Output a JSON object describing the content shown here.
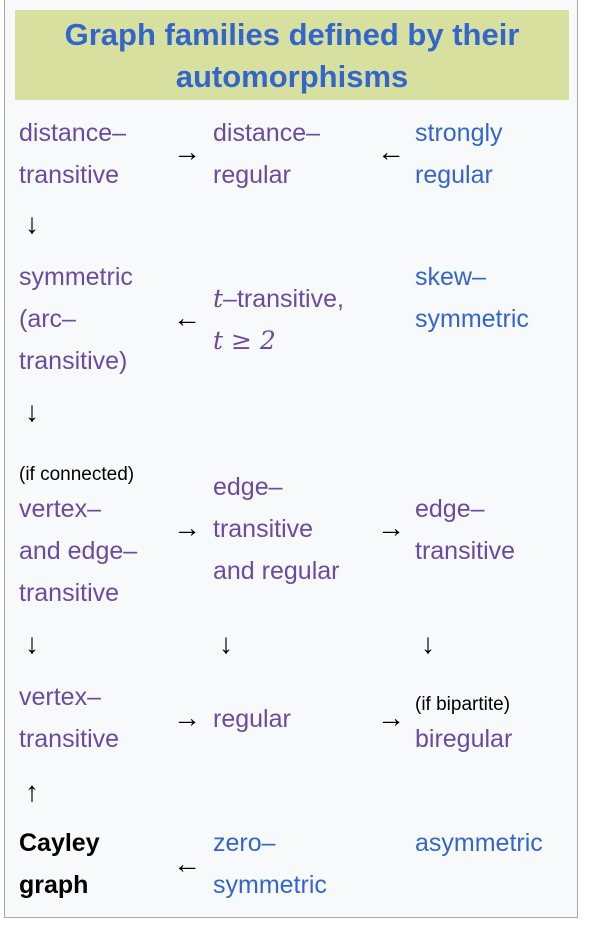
{
  "title": "Graph families defined by their automorphisms",
  "title_color": "#3366cc",
  "title_bg": "#d8e0a0",
  "link_color": "#3366cc",
  "visited_color": "#6b4ba1",
  "nodes": {
    "distance_transitive": [
      "distance–",
      "transitive"
    ],
    "distance_regular": [
      "distance–",
      "regular"
    ],
    "strongly_regular": [
      "strongly",
      "regular"
    ],
    "symmetric": [
      "symmetric",
      "(arc–",
      "transitive)"
    ],
    "t_transitive": {
      "t": "t",
      "rest": "–transitive,",
      "condition": "t ≥ 2"
    },
    "skew_symmetric": [
      "skew–",
      "symmetric"
    ],
    "vertex_and_edge": {
      "note": "(if connected)",
      "lines": [
        "vertex–",
        "and edge–",
        "transitive"
      ]
    },
    "edge_transitive_regular": [
      "edge–",
      "transitive",
      "and regular"
    ],
    "edge_transitive": [
      "edge–",
      "transitive"
    ],
    "vertex_transitive": [
      "vertex–",
      "transitive"
    ],
    "regular": "regular",
    "biregular": {
      "note": "(if bipartite)",
      "label": "biregular"
    },
    "cayley_graph": [
      "Cayley",
      "graph"
    ],
    "zero_symmetric": [
      "zero–",
      "symmetric"
    ],
    "asymmetric": "asymmetric"
  },
  "arrows": {
    "right": "→",
    "left": "←",
    "down": "↓",
    "up": "↑"
  }
}
